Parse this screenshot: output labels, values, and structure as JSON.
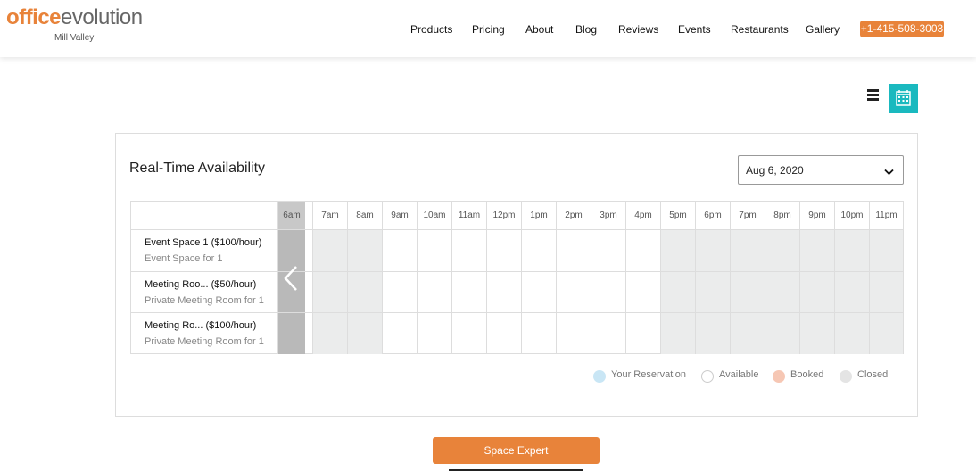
{
  "header": {
    "logo_part1": "office",
    "logo_part2": "evolution",
    "location": "Mill Valley",
    "nav": [
      "Products",
      "Pricing",
      "About",
      "Blog",
      "Reviews",
      "Events",
      "Restaurants",
      "Gallery"
    ],
    "phone": "+1-415-508-3003"
  },
  "view_toggle": {
    "list_icon": "list-icon",
    "calendar_icon": "calendar-icon"
  },
  "availability": {
    "title": "Real-Time Availability",
    "date": "Aug 6, 2020",
    "hours": [
      "6am",
      "7am",
      "8am",
      "9am",
      "10am",
      "11am",
      "12pm",
      "1pm",
      "2pm",
      "3pm",
      "4pm",
      "5pm",
      "6pm",
      "7pm",
      "8pm",
      "9pm",
      "10pm",
      "11pm"
    ],
    "rows": [
      {
        "name": "Event Space 1 ($100/hour)",
        "desc": "Event Space for 1"
      },
      {
        "name": "Meeting Roo...  ($50/hour)",
        "desc": "Private Meeting Room for 1"
      },
      {
        "name": "Meeting Ro...  ($100/hour)",
        "desc": "Private Meeting Room for 1"
      }
    ],
    "legend": [
      {
        "label": "Your Reservation",
        "color": "#c9e6f5"
      },
      {
        "label": "Available",
        "color": "#ffffff"
      },
      {
        "label": "Booked",
        "color": "#f6c7b4"
      },
      {
        "label": "Closed",
        "color": "#e4e4e4"
      }
    ]
  },
  "cta": "Space Expert",
  "colors": {
    "accent": "#e8833a",
    "teal": "#1ab9bf",
    "closed": "#ebecec"
  }
}
